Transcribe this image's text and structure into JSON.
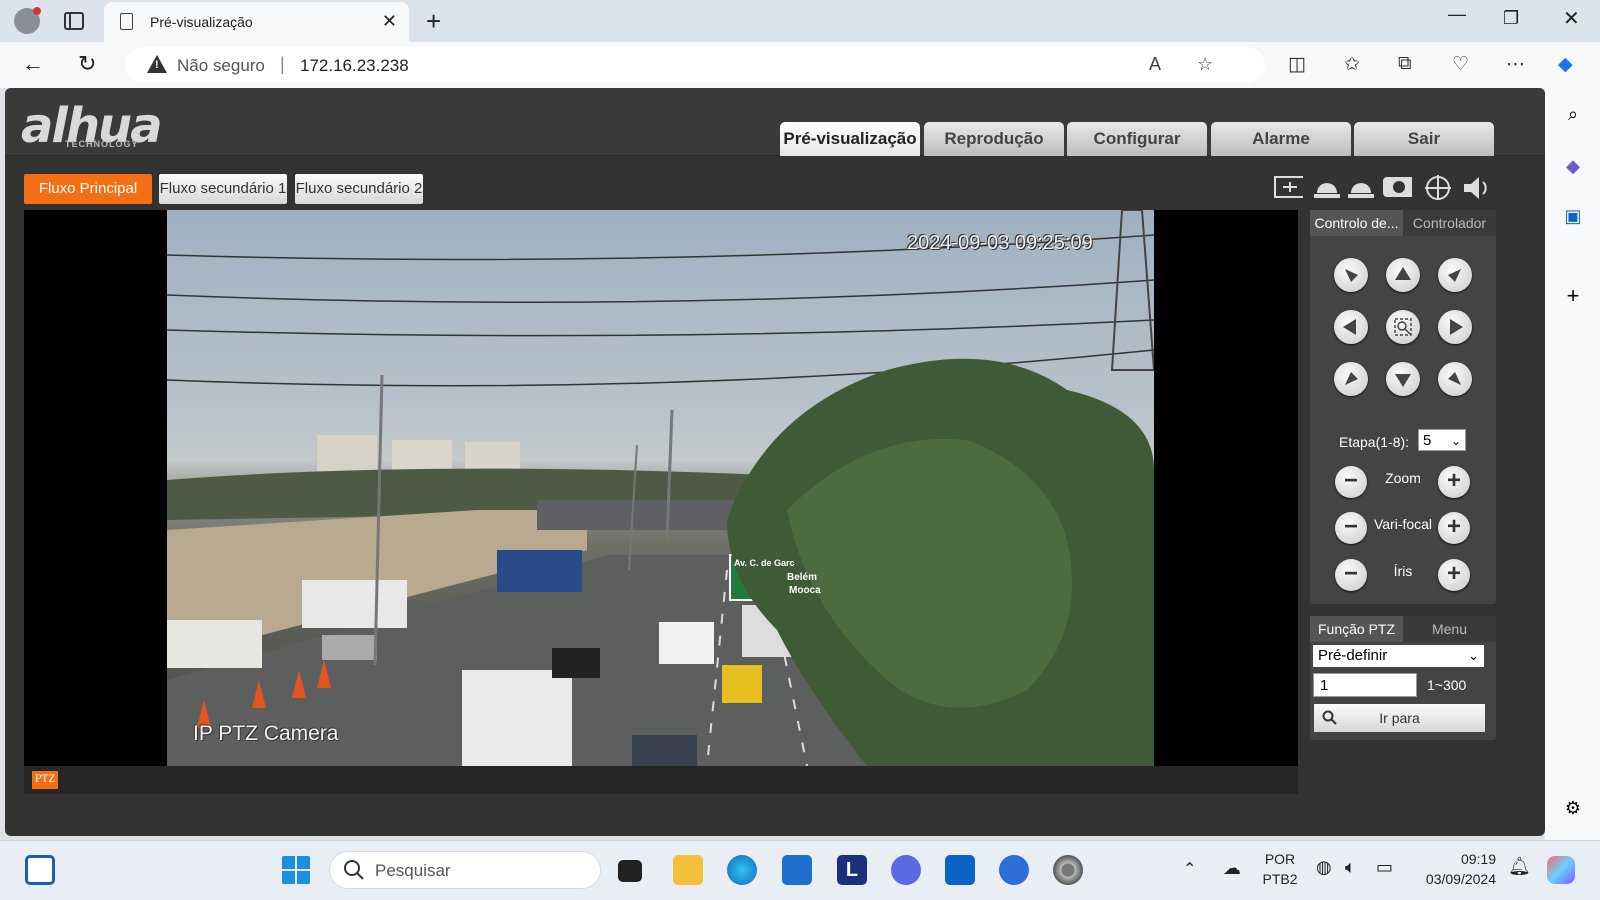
{
  "browser": {
    "tab_title": "Pré-visualização",
    "security_label": "Não seguro",
    "url": "172.16.23.238"
  },
  "app": {
    "logo": "alhua",
    "logo_sub": "TECHNOLOGY",
    "main_tabs": [
      "Pré-visualização",
      "Reprodução",
      "Configurar",
      "Alarme",
      "Sair"
    ],
    "active_tab": "Pré-visualização",
    "streams": [
      "Fluxo Principal",
      "Fluxo secundário 1",
      "Fluxo secundário 2"
    ],
    "active_stream": "Fluxo Principal",
    "toolbar_icons": [
      "fullscreen-icon",
      "alarm-light-icon",
      "alarm-light-2-icon",
      "record-icon",
      "crosshair-icon",
      "speaker-icon"
    ],
    "video": {
      "timestamp": "2024-09-03 09:25:09",
      "camera_label": "IP PTZ Camera",
      "sign_text": [
        "Av. C. de Garc",
        "Belém",
        "Mooca"
      ]
    },
    "ptz_badge": "PTZ",
    "ptz_panel": {
      "tabs": [
        "Controlo de...",
        "Controlador"
      ],
      "step_label": "Etapa(1-8):",
      "step_value": "5",
      "zoom_label": "Zoom",
      "focus_label": "Vari-focal",
      "iris_label": "Íris",
      "accent": "#f26f13"
    },
    "function_panel": {
      "tabs": [
        "Função PTZ",
        "Menu"
      ],
      "function_select": "Pré-definir",
      "preset_value": "1",
      "range": "1~300",
      "goto_label": "Ir para"
    }
  },
  "taskbar": {
    "search_placeholder": "Pesquisar",
    "lang_top": "POR",
    "lang_bottom": "PTB2",
    "time": "09:19",
    "date": "03/09/2024"
  }
}
